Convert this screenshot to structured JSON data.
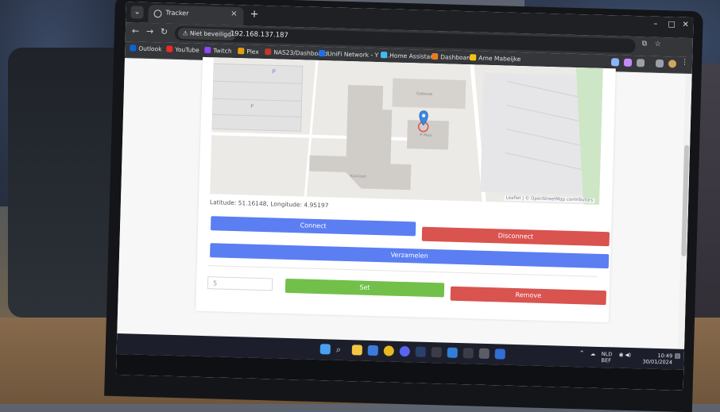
{
  "browser": {
    "tab_title": "Tracker",
    "tab_close": "×",
    "new_tab": "+",
    "security_label": "Niet beveiligd",
    "url": "192.168.137.187",
    "nav": {
      "back": "←",
      "forward": "→",
      "reload": "↻"
    },
    "window": {
      "minimize": "–",
      "maximize": "□",
      "close": "✕"
    }
  },
  "bookmarks": [
    {
      "label": "Outlook",
      "color": "#0a64d6"
    },
    {
      "label": "YouTube",
      "color": "#e52d27"
    },
    {
      "label": "Twitch",
      "color": "#9146ff"
    },
    {
      "label": "Plex",
      "color": "#e5a00d"
    },
    {
      "label": "NAS23/Dashboard",
      "color": "#c0392b"
    },
    {
      "label": "UniFi Network - Y R...",
      "color": "#1f6feb"
    },
    {
      "label": "Home Assistant",
      "color": "#41bdf5"
    },
    {
      "label": "Dashboard",
      "color": "#e67e22"
    },
    {
      "label": "Arne Mabeijke",
      "color": "#f1c40f"
    }
  ],
  "map": {
    "labels": [
      "P",
      "P",
      "Gebouw",
      "P Max",
      "Kaviaan"
    ],
    "attribution": "Leaflet | © OpenStreetMap contributors"
  },
  "coordinates_text": "Latitude: 51.16148, Longitude: 4.95197",
  "buttons": {
    "connect": "Connect",
    "disconnect": "Disconnect",
    "collect": "Verzamelen",
    "set": "Set",
    "remove": "Remove"
  },
  "interval_input": {
    "value": "5"
  },
  "colors": {
    "blue": "#5b7ef2",
    "red": "#d9534f",
    "green": "#72c04a"
  },
  "tray": {
    "lang": "NLD",
    "lang_sub": "BEF",
    "time": "10:49",
    "date": "30/01/2024"
  }
}
